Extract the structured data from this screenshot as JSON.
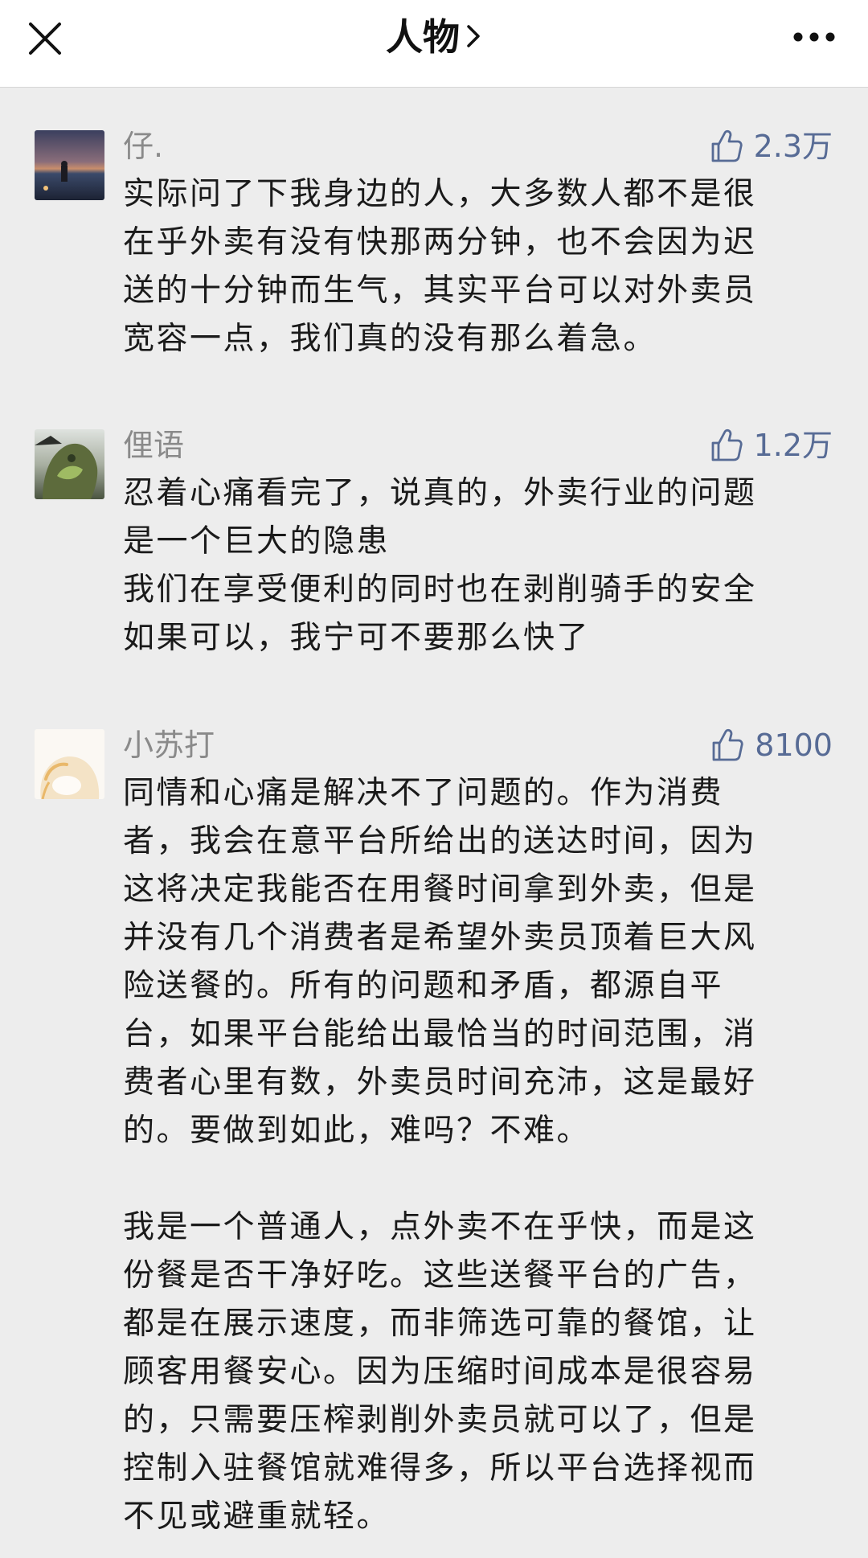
{
  "header": {
    "title": "人物",
    "close_icon": "close-icon",
    "more_icon": "more-icon"
  },
  "colors": {
    "nav_bg": "#ffffff",
    "page_bg": "#ededed",
    "name": "#8a8a8a",
    "like": "#576b95",
    "text": "#1a1a1a"
  },
  "comments": [
    {
      "username": "仔.",
      "likes": "2.3万",
      "paragraphs": [
        "实际问了下我身边的人，大多数人都不是很\n在乎外卖有没有快那两分钟，也不会因为迟\n送的十分钟而生气，其实平台可以对外卖员\n宽容一点，我们真的没有那么着急。"
      ]
    },
    {
      "username": "俚语",
      "likes": "1.2万",
      "paragraphs": [
        "忍着心痛看完了，说真的，外卖行业的问题\n是一个巨大的隐患\n我们在享受便利的同时也在剥削骑手的安全\n如果可以，我宁可不要那么快了"
      ]
    },
    {
      "username": "小苏打",
      "likes": "8100",
      "paragraphs": [
        "同情和心痛是解决不了问题的。作为消费\n者，我会在意平台所给出的送达时间，因为\n这将决定我能否在用餐时间拿到外卖，但是\n并没有几个消费者是希望外卖员顶着巨大风\n险送餐的。所有的问题和矛盾，都源自平\n台，如果平台能给出最恰当的时间范围，消\n费者心里有数，外卖员时间充沛，这是最好\n的。要做到如此，难吗？不难。",
        "我是一个普通人，点外卖不在乎快，而是这\n份餐是否干净好吃。这些送餐平台的广告，\n都是在展示速度，而非筛选可靠的餐馆，让\n顾客用餐安心。因为压缩时间成本是很容易\n的，只需要压榨剥削外卖员就可以了，但是\n控制入驻餐馆就难得多，所以平台选择视而\n不见或避重就轻。"
      ]
    }
  ]
}
